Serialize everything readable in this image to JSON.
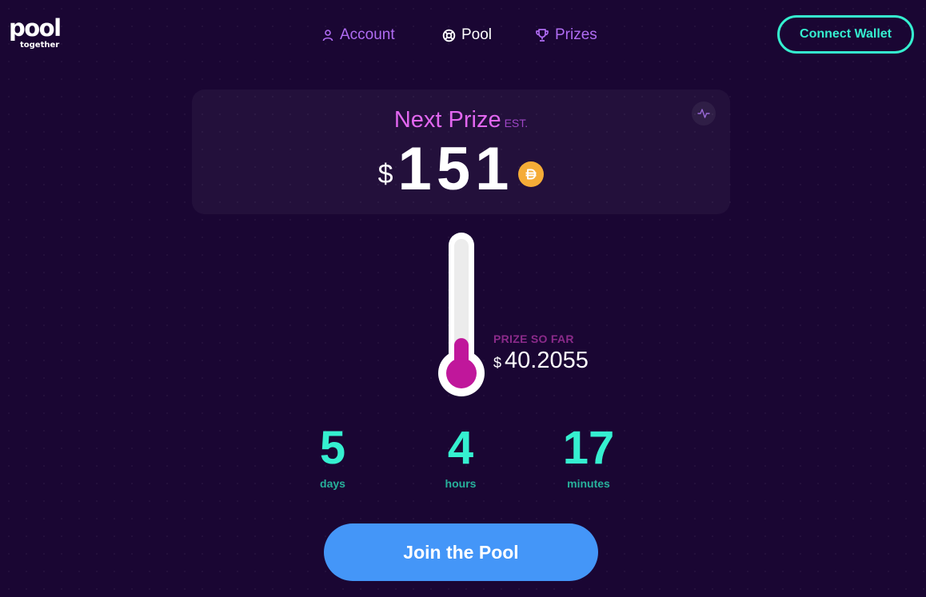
{
  "logo": {
    "main": "pool",
    "sub": "together"
  },
  "nav": {
    "items": [
      {
        "label": "Account",
        "icon": "user-icon"
      },
      {
        "label": "Pool",
        "icon": "lifebuoy-icon",
        "active": true
      },
      {
        "label": "Prizes",
        "icon": "trophy-icon"
      }
    ]
  },
  "header": {
    "connect_label": "Connect Wallet"
  },
  "prize": {
    "title": "Next Prize",
    "est": "EST.",
    "currency": "$",
    "amount": "151",
    "token_icon": "dai-coin-icon",
    "activity_icon": "activity-icon"
  },
  "progress": {
    "label": "PRIZE SO FAR",
    "currency": "$",
    "value": "40.2055",
    "fill_fraction": 0.27
  },
  "countdown": {
    "days": {
      "value": "5",
      "label": "days"
    },
    "hours": {
      "value": "4",
      "label": "hours"
    },
    "minutes": {
      "value": "17",
      "label": "minutes"
    }
  },
  "cta": {
    "join_label": "Join the Pool"
  },
  "colors": {
    "background": "#1a0633",
    "accent_teal": "#35f0d0",
    "accent_purple": "#b06cf3",
    "prize_pink": "#e267f0",
    "thermo_fill": "#c0179b",
    "button_blue": "#4496f8",
    "dai_gold": "#f5ac37"
  }
}
